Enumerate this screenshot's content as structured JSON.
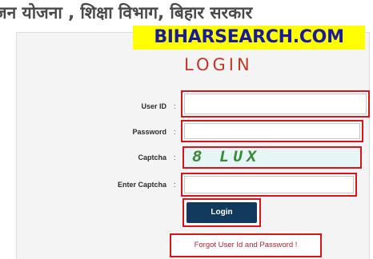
{
  "header": {
    "title": "जन योजना , शिक्षा विभाग, बिहार सरकार"
  },
  "watermark": {
    "text": "BIHARSEARCH.COM"
  },
  "login_form": {
    "heading": "LOGIN",
    "fields": {
      "user_id": {
        "label": "User ID",
        "value": "",
        "placeholder": ""
      },
      "password": {
        "label": "Password",
        "value": "",
        "placeholder": ""
      },
      "captcha": {
        "label": "Captcha",
        "code": "8 LUX"
      },
      "enter_captcha": {
        "label": "Enter Captcha",
        "value": "",
        "placeholder": ""
      }
    },
    "separator": ":",
    "login_button_label": "Login",
    "forgot_link": "Forgot User Id and Password !"
  },
  "colors": {
    "highlight_border": "#d9141a",
    "button_bg": "#123a5e",
    "heading_red": "#c0392b",
    "watermark_bg": "#ffff00",
    "watermark_text": "#1a1a9e"
  }
}
